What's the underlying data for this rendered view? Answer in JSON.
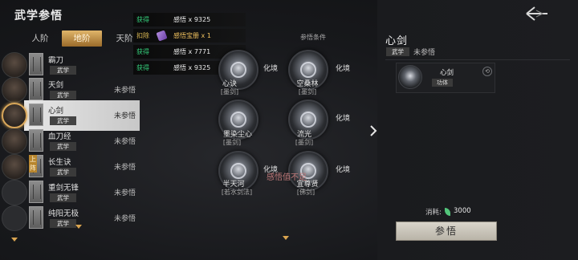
{
  "title": "武学参悟",
  "tabs": [
    {
      "label": "人阶"
    },
    {
      "label": "地阶"
    },
    {
      "label": "天阶"
    }
  ],
  "skills": [
    {
      "name": "霸刀",
      "type": "武学",
      "status": ""
    },
    {
      "name": "天剑",
      "type": "武学",
      "status": "未参悟"
    },
    {
      "name": "心剑",
      "type": "武学",
      "status": "未参悟"
    },
    {
      "name": "血刀经",
      "type": "武学",
      "status": "未参悟"
    },
    {
      "name": "长生诀",
      "type": "武学",
      "status": "未参悟"
    },
    {
      "name": "重剑无锋",
      "type": "武学",
      "status": "未参悟"
    },
    {
      "name": "纯阳无极",
      "type": "武学",
      "status": "未参悟"
    }
  ],
  "badge_text": "上阵",
  "notifications": [
    {
      "action": "获得",
      "item": "感悟 x 9325"
    },
    {
      "action": "扣除",
      "item": "感悟宝册 x 1"
    },
    {
      "action": "获得",
      "item": "感悟 x 7771"
    },
    {
      "action": "获得",
      "item": "感悟 x 9325"
    }
  ],
  "conditions_label": "参悟条件",
  "nodes": [
    {
      "name": "心诀",
      "sub": "[墨剑]",
      "trans": "化境"
    },
    {
      "name": "空桑林",
      "sub": "[墨剑]",
      "trans": "化境"
    },
    {
      "name": "墨染尘心",
      "sub": "[墨剑]",
      "trans": ""
    },
    {
      "name": "流光",
      "sub": "[墨剑]",
      "trans": "化境"
    },
    {
      "name": "半天河",
      "sub": "[若水剑法]",
      "trans": "化境"
    },
    {
      "name": "宜尊贤",
      "sub": "[佛剑]",
      "trans": "化境"
    }
  ],
  "tip": "感悟值不足",
  "panel": {
    "title": "心剑",
    "type": "武学",
    "status": "未参悟",
    "card_name": "心剑",
    "card_tag": "功体",
    "cost_label": "消耗:",
    "cost_value": "3000",
    "button": "参悟"
  },
  "colors": {
    "accent_gold": "#d9a450",
    "gain_green": "#35d07c",
    "remove_gold": "#e0bd55"
  }
}
